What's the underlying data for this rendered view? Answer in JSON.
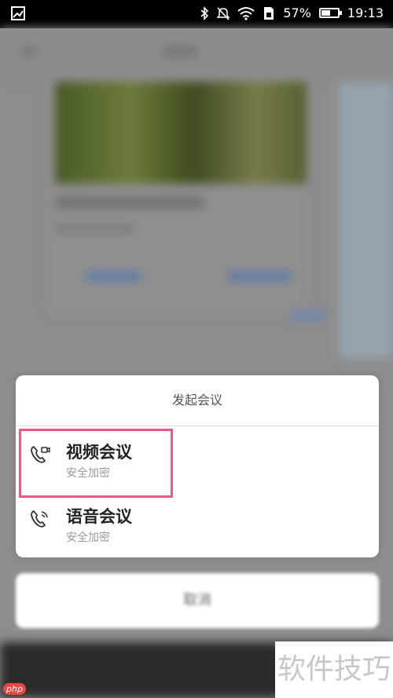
{
  "status_bar": {
    "battery": "57%",
    "time": "19:13",
    "battery_level": 0.57,
    "icons": [
      "image-icon",
      "bluetooth-icon",
      "mute-icon",
      "wifi-icon",
      "sim-icon",
      "battery-icon"
    ]
  },
  "background": {
    "title": "2020",
    "left_text": "20",
    "menu": "···"
  },
  "sheet": {
    "title": "发起会议",
    "options": [
      {
        "label": "视频会议",
        "sub": "安全加密",
        "icon": "video-call-icon"
      },
      {
        "label": "语音会议",
        "sub": "安全加密",
        "icon": "voice-call-icon"
      }
    ],
    "cancel": "取消"
  },
  "watermark": {
    "text": "软件技巧",
    "logo": "php"
  },
  "colors": {
    "highlight": "#e85a8a",
    "sheet_bg": "#ffffff"
  }
}
